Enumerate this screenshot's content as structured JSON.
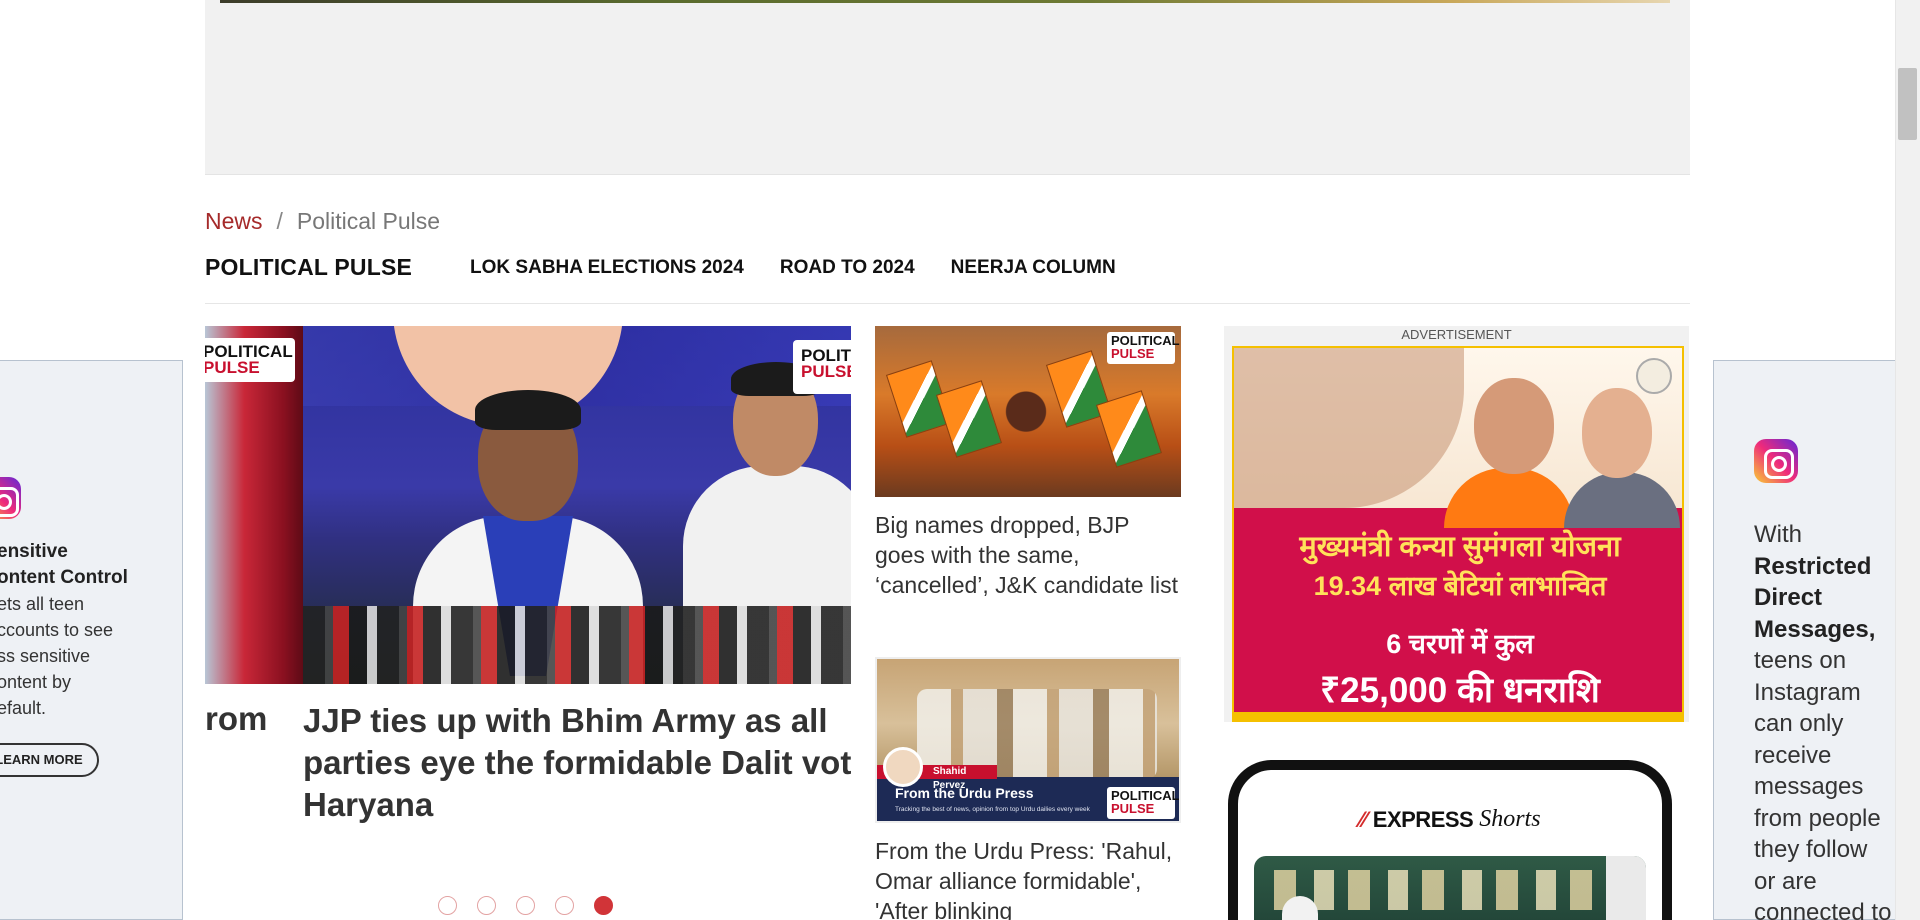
{
  "breadcrumb": {
    "home": "News",
    "separator": "/",
    "current": "Political Pulse"
  },
  "section_nav": {
    "title": "POLITICAL PULSE",
    "items": [
      "LOK SABHA ELECTIONS 2024",
      "ROAD TO 2024",
      "NEERJA COLUMN"
    ]
  },
  "badge": {
    "line1_a": "POLITICAL",
    "line2_a": "PULSE"
  },
  "carousel": {
    "prev_headline_fragment": "rom",
    "headline": "JJP ties up with Bhim Army as all parties eye the formidable Dalit vote in Haryana",
    "slide_count": 5,
    "active_index": 4
  },
  "stories": [
    {
      "title": "Big names dropped, BJP goes with the same, ‘cancelled’, J&K candidate list"
    },
    {
      "title": "From the Urdu Press: 'Rahul, Omar alliance formidable', 'After blinking",
      "thumb_author": "Shahid Pervez",
      "thumb_title": "From the Urdu Press",
      "thumb_sub": "Tracking the best of news, opinion from top Urdu dailies every week"
    }
  ],
  "ad_right": {
    "label": "ADVERTISEMENT",
    "line1": "मुख्यमंत्री कन्या सुमंगला योजना",
    "line2": "19.34 लाख बेटियां लाभान्वित",
    "line3": "6 चरणों में कुल",
    "line4": "₹25,000 की धनराशि"
  },
  "shorts": {
    "brand": "EXPRESS",
    "suffix": "Shorts"
  },
  "side_ad_left": {
    "title_line1": "ensitive",
    "title_line2": "ontent Control",
    "body": [
      "ets all teen",
      "ccounts to see",
      "ss sensitive",
      "ontent by",
      "efault."
    ],
    "cta": "LEARN MORE"
  },
  "side_ad_right": {
    "lines": [
      "With",
      "Restricted",
      "Direct",
      "Messages,",
      "teens on",
      "Instagram",
      "can only",
      "receive",
      "messages",
      "from people",
      "they follow",
      "or are",
      "connected to"
    ]
  },
  "colors": {
    "accent_red": "#d13438",
    "breadcrumb_link": "#a52a2a"
  }
}
